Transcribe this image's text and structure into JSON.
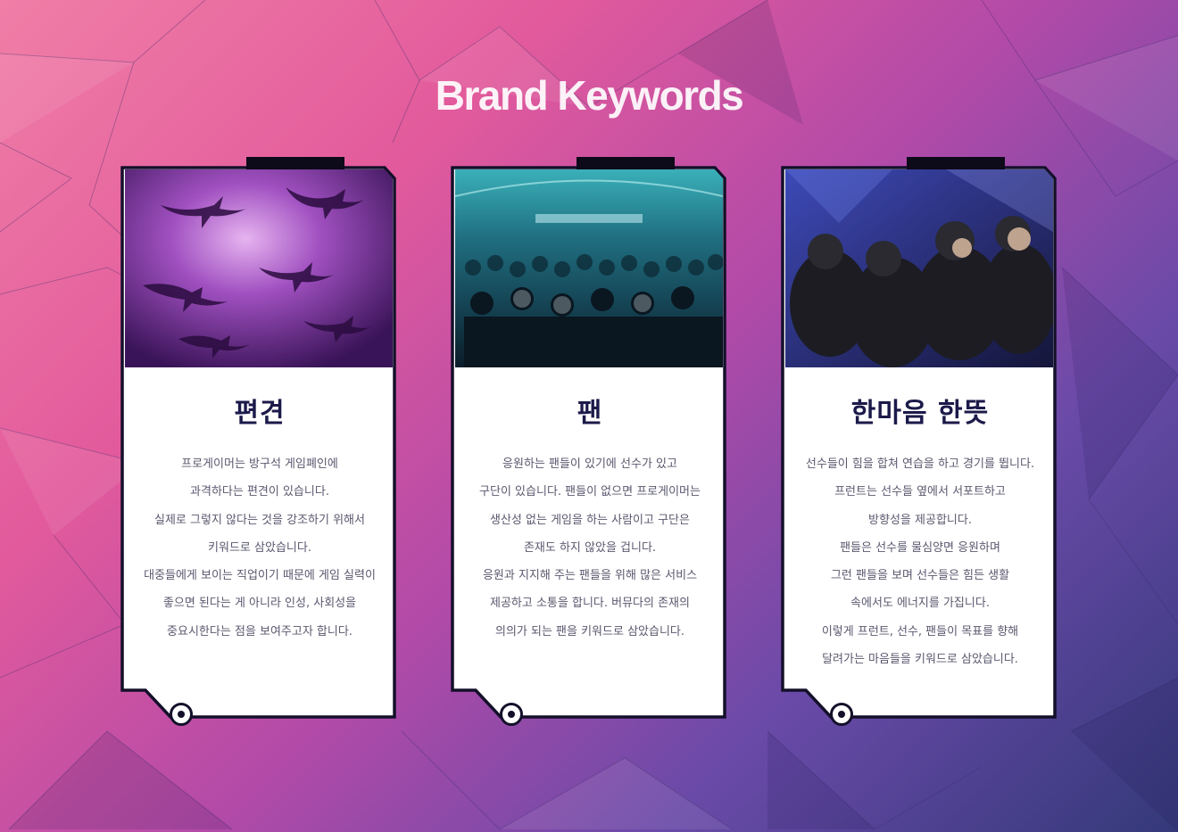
{
  "page": {
    "title": "Brand Keywords"
  },
  "cards": [
    {
      "photo_subject": "sharks swimming above in purple water",
      "title": "편견",
      "lines": [
        "프로게이머는 방구석 게임폐인에",
        "과격하다는 편견이 있습니다.",
        "실제로 그렇지 않다는 것을 강조하기 위해서",
        "키워드로 삼았습니다.",
        "대중들에게 보이는 직업이기 때문에 게임 실력이",
        "좋으면 된다는 게 아니라 인성, 사회성을",
        "중요시한다는 점을 보여주고자 합니다."
      ]
    },
    {
      "photo_subject": "crowd of fans in an arena",
      "title": "팬",
      "lines": [
        "응원하는 팬들이 있기에 선수가 있고",
        "구단이 있습니다. 팬들이 없으면 프로게이머는",
        "생산성 없는 게임을 하는 사람이고 구단은",
        "존재도 하지 않았을 겁니다.",
        "응원과 지지해 주는 팬들을 위해 많은 서비스",
        "제공하고 소통을 합니다. 버뮤다의 존재의",
        "의의가 되는 팬을 키워드로 삼았습니다."
      ]
    },
    {
      "photo_subject": "team players hugging on stage",
      "title": "한마음 한뜻",
      "lines": [
        "선수들이 힘을 합쳐 연습을 하고 경기를 뜁니다.",
        "프런트는 선수들 옆에서 서포트하고",
        "방향성을 제공합니다.",
        "팬들은 선수를 물심양면 응원하며",
        "그런 팬들을 보며 선수들은 힘든 생활",
        "속에서도 에너지를 가집니다.",
        "이렇게 프런트, 선수, 팬들이 목표를 향해",
        "달려가는 마음들을 키워드로 삼았습니다."
      ]
    }
  ],
  "colors": {
    "bg_pink": "#f07ea6",
    "bg_magenta": "#e25a9c",
    "bg_purple": "#6a4aa8",
    "bg_navy": "#34397a",
    "card_border": "#14102a",
    "card_title": "#1c1a4a",
    "body_text": "#5a586e"
  }
}
